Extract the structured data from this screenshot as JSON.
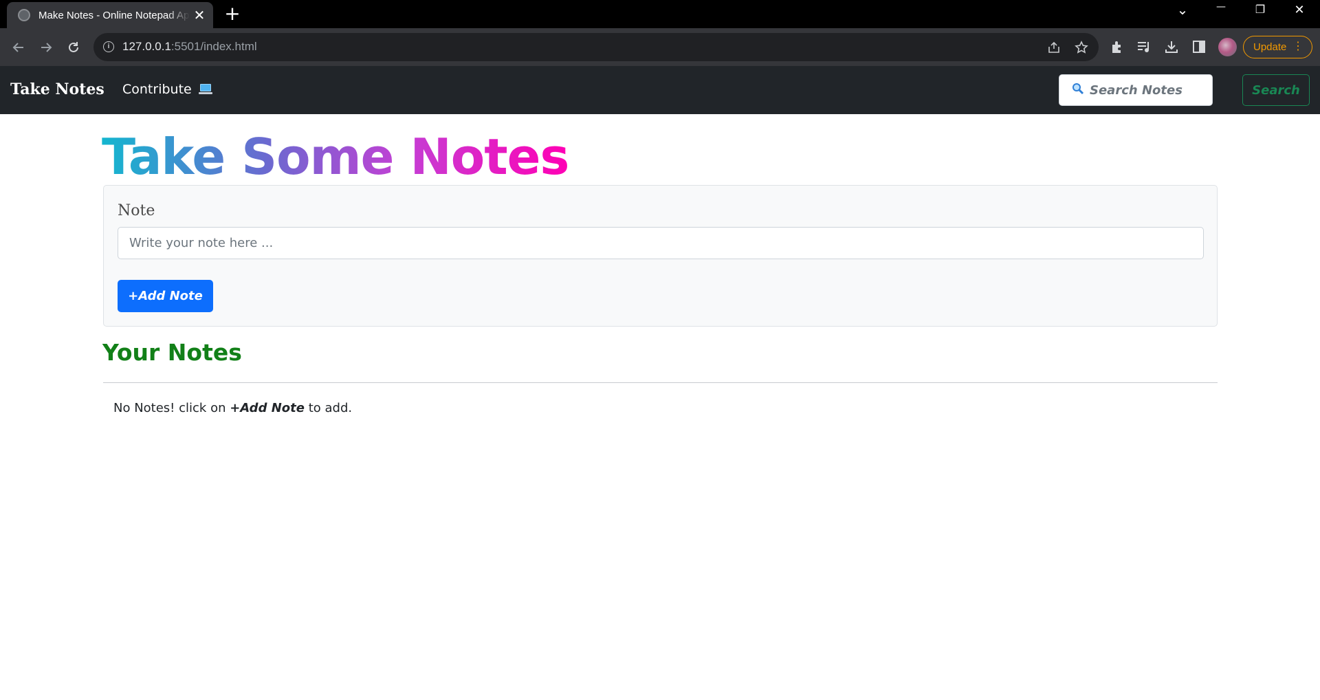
{
  "browser": {
    "tab_title": "Make Notes - Online Notepad App",
    "tab_close": "✕",
    "new_tab": "+",
    "window_controls": {
      "dropdown": "⌄",
      "minimize": "—",
      "restore": "❐",
      "close": "✕"
    },
    "url_host": "127.0.0.1",
    "url_rest": ":5501/index.html",
    "update_label": "Update",
    "update_menu": "⋮",
    "icons": [
      "back-arrow-icon",
      "forward-arrow-icon",
      "reload-icon",
      "info-icon",
      "share-icon",
      "star-icon",
      "extensions-icon",
      "media-icon",
      "download-icon",
      "side-panel-icon"
    ]
  },
  "navbar": {
    "brand": "Take Notes",
    "contribute_label": "Contribute",
    "search_placeholder": "Search Notes",
    "search_button": "Search"
  },
  "main": {
    "title": "Take Some Notes",
    "note_label": "Note",
    "note_placeholder": "Write your note here ...",
    "add_button": "+Add Note",
    "your_notes_heading": "Your Notes",
    "empty_before": "No Notes! click on ",
    "empty_bold": "+Add Note",
    "empty_after": " to add."
  },
  "colors": {
    "navbar_bg": "#212529",
    "primary": "#0d6efd",
    "success": "#198754",
    "heading_green": "#128018",
    "gradient_start": "#14b6cf",
    "gradient_end": "#ff00b4",
    "update_orange": "#f29900"
  }
}
